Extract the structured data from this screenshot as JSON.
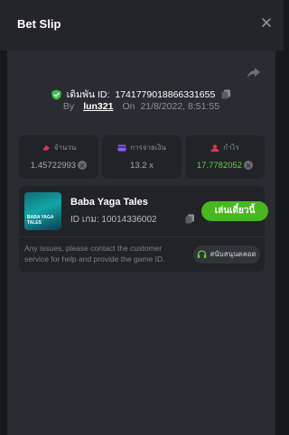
{
  "header": {
    "title": "Bet Slip"
  },
  "bet": {
    "id_label": "เดิมพัน ID:",
    "id_value": "1741779018866331655",
    "by_label": "By",
    "username": "lun321",
    "on_label": "On",
    "datetime": "21/8/2022, 8:51:55"
  },
  "stats": [
    {
      "label": "จำนวน",
      "value": "1.45722993",
      "icon": "bet-amount-icon",
      "icon_color": "#e0344f"
    },
    {
      "label": "การจ่ายเงิน",
      "value": "13.2 x",
      "icon": "payout-card-icon",
      "icon_color": "#8b5cf6"
    },
    {
      "label": "กำไร",
      "value": "17.7782052",
      "icon": "profit-icon",
      "icon_color": "#e0344f",
      "value_color": "#5ed63a"
    }
  ],
  "game": {
    "thumbnail_text": "BABA YAGA TALES",
    "name": "Baba Yaga Tales",
    "id_label": "ID เกม:",
    "id_value": "10014336002",
    "play_label": "เล่นเดี๋ยวนี้",
    "note": "Any issues, please contact the customer service for help and provide the game ID.",
    "support_label": "สนับสนุนตลอด"
  },
  "colors": {
    "accent_green": "#47b81d",
    "panel": "#2b2c31",
    "background": "#17181b"
  }
}
